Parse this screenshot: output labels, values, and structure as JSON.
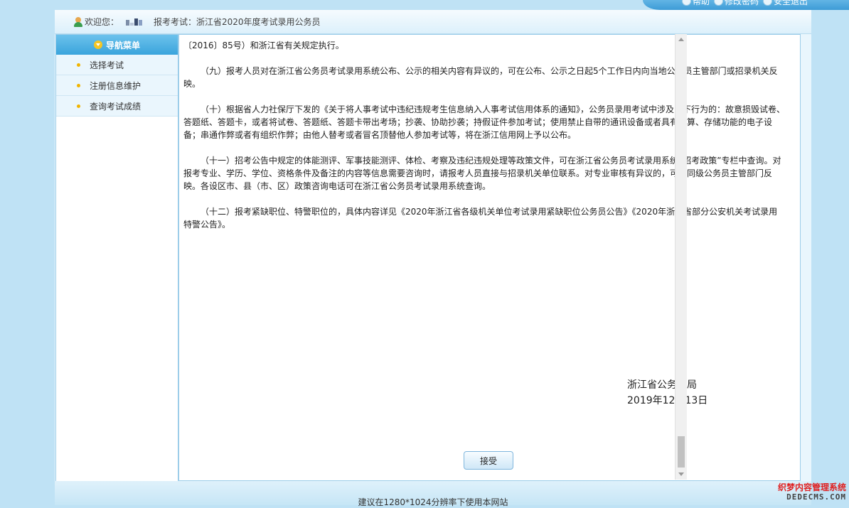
{
  "top_links": {
    "help": "帮助",
    "change_password": "修改密码",
    "logout": "安全退出"
  },
  "welcome": {
    "label": "欢迎您：",
    "exam_info": "报考考试：浙江省2020年度考试录用公务员"
  },
  "sidebar": {
    "header": "导航菜单",
    "items": [
      {
        "label": "选择考试"
      },
      {
        "label": "注册信息维护"
      },
      {
        "label": "查询考试成绩"
      }
    ]
  },
  "content": {
    "paragraphs": [
      "〔2016〕85号）和浙江省有关规定执行。",
      "（九）报考人员对在浙江省公务员考试录用系统公布、公示的相关内容有异议的，可在公布、公示之日起5个工作日内向当地公务员主管部门或招录机关反映。",
      "（十）根据省人力社保厅下发的《关于将人事考试中违纪违规考生信息纳入人事考试信用体系的通知》，公务员录用考试中涉及以下行为的：故意损毁试卷、答题纸、答题卡，或者将试卷、答题纸、答题卡带出考场；抄袭、协助抄袭；持假证件参加考试；使用禁止自带的通讯设备或者具有计算、存储功能的电子设备；串通作弊或者有组织作弊；由他人替考或者冒名顶替他人参加考试等，将在浙江信用网上予以公布。",
      "（十一）招考公告中规定的体能测评、军事技能测评、体检、考察及违纪违规处理等政策文件，可在浙江省公务员考试录用系统“招考政策”专栏中查询。对报考专业、学历、学位、资格条件及备注的内容等信息需要咨询时，请报考人员直接与招录机关单位联系。对专业审核有异议的，可向同级公务员主管部门反映。各设区市、县（市、区）政策咨询电话可在浙江省公务员考试录用系统查询。",
      "（十二）报考紧缺职位、特警职位的，具体内容详见《2020年浙江省各级机关单位考试录用紧缺职位公务员公告》《2020年浙江省部分公安机关考试录用特警公告》。"
    ],
    "signature_org": "浙江省公务员局",
    "signature_date": "2019年12月13日",
    "accept_button": "接受"
  },
  "footer": {
    "text": "建议在1280*1024分辨率下使用本网站"
  },
  "watermark": {
    "line1": "织梦内容管理系统",
    "line2": "DEDECMS.COM"
  }
}
